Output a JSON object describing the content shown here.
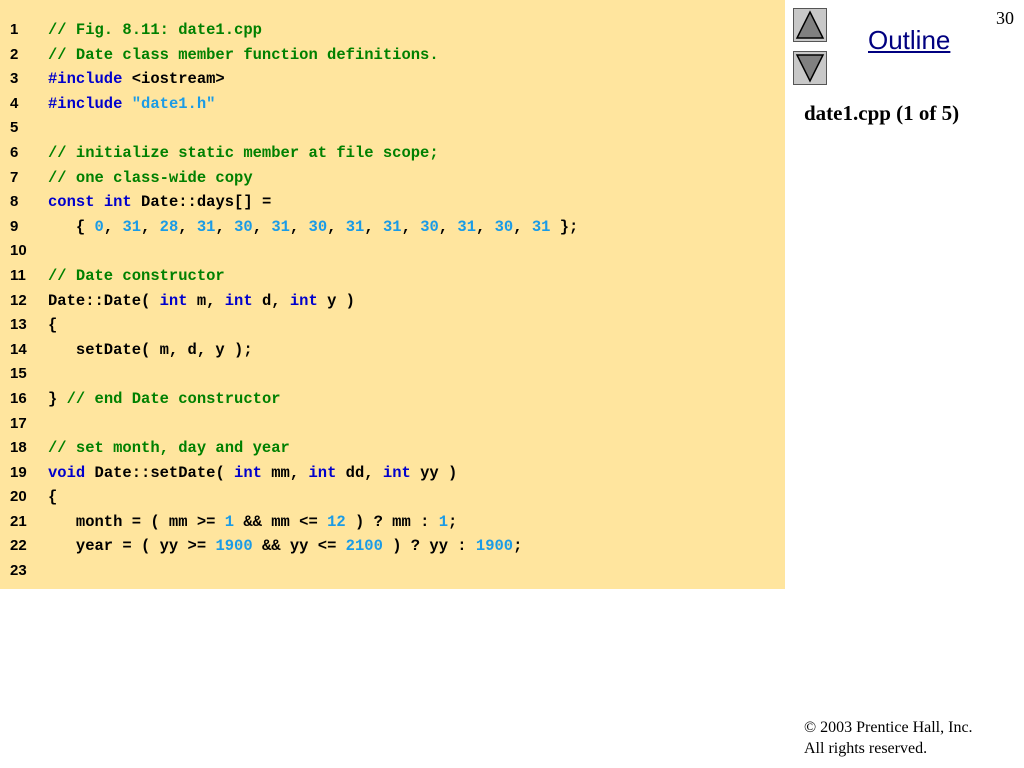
{
  "slide": {
    "page_number": "30",
    "outline_label": "Outline",
    "file_label": "date1.cpp (1 of 5)",
    "copyright_line1": "© 2003 Prentice Hall, Inc.",
    "copyright_line2": "All rights reserved.",
    "nav_up_icon": "triangle-up-icon",
    "nav_down_icon": "triangle-down-icon"
  },
  "colors": {
    "panel_background": "#ffe59e",
    "comment": "#008000",
    "keyword": "#0000cc",
    "number": "#1a9be6",
    "string": "#1a9be6",
    "plain": "#000000",
    "outline_link": "#000080"
  },
  "code_lines": [
    {
      "number": "1",
      "tokens": [
        {
          "t": "// Fig. 8.11: date1.cpp",
          "k": "comment"
        }
      ]
    },
    {
      "number": "2",
      "tokens": [
        {
          "t": "// Date class member function definitions.",
          "k": "comment"
        }
      ]
    },
    {
      "number": "3",
      "tokens": [
        {
          "t": "#include",
          "k": "keyword"
        },
        {
          "t": " <iostream>",
          "k": "plain"
        }
      ]
    },
    {
      "number": "4",
      "tokens": [
        {
          "t": "#include",
          "k": "keyword"
        },
        {
          "t": " ",
          "k": "plain"
        },
        {
          "t": "\"date1.h\"",
          "k": "string"
        }
      ]
    },
    {
      "number": "5",
      "tokens": []
    },
    {
      "number": "6",
      "tokens": [
        {
          "t": "// initialize static member at file scope;",
          "k": "comment"
        }
      ]
    },
    {
      "number": "7",
      "tokens": [
        {
          "t": "// one class-wide copy",
          "k": "comment"
        }
      ]
    },
    {
      "number": "8",
      "tokens": [
        {
          "t": "const",
          "k": "keyword"
        },
        {
          "t": " ",
          "k": "plain"
        },
        {
          "t": "int",
          "k": "keyword"
        },
        {
          "t": " Date::days[] =",
          "k": "plain"
        }
      ]
    },
    {
      "number": "9",
      "tokens": [
        {
          "t": "   { ",
          "k": "plain"
        },
        {
          "t": "0",
          "k": "number"
        },
        {
          "t": ", ",
          "k": "plain"
        },
        {
          "t": "31",
          "k": "number"
        },
        {
          "t": ", ",
          "k": "plain"
        },
        {
          "t": "28",
          "k": "number"
        },
        {
          "t": ", ",
          "k": "plain"
        },
        {
          "t": "31",
          "k": "number"
        },
        {
          "t": ", ",
          "k": "plain"
        },
        {
          "t": "30",
          "k": "number"
        },
        {
          "t": ", ",
          "k": "plain"
        },
        {
          "t": "31",
          "k": "number"
        },
        {
          "t": ", ",
          "k": "plain"
        },
        {
          "t": "30",
          "k": "number"
        },
        {
          "t": ", ",
          "k": "plain"
        },
        {
          "t": "31",
          "k": "number"
        },
        {
          "t": ", ",
          "k": "plain"
        },
        {
          "t": "31",
          "k": "number"
        },
        {
          "t": ", ",
          "k": "plain"
        },
        {
          "t": "30",
          "k": "number"
        },
        {
          "t": ", ",
          "k": "plain"
        },
        {
          "t": "31",
          "k": "number"
        },
        {
          "t": ", ",
          "k": "plain"
        },
        {
          "t": "30",
          "k": "number"
        },
        {
          "t": ", ",
          "k": "plain"
        },
        {
          "t": "31",
          "k": "number"
        },
        {
          "t": " };",
          "k": "plain"
        }
      ]
    },
    {
      "number": "10",
      "tokens": []
    },
    {
      "number": "11",
      "tokens": [
        {
          "t": "// Date constructor",
          "k": "comment"
        }
      ]
    },
    {
      "number": "12",
      "tokens": [
        {
          "t": "Date::Date( ",
          "k": "plain"
        },
        {
          "t": "int",
          "k": "keyword"
        },
        {
          "t": " m, ",
          "k": "plain"
        },
        {
          "t": "int",
          "k": "keyword"
        },
        {
          "t": " d, ",
          "k": "plain"
        },
        {
          "t": "int",
          "k": "keyword"
        },
        {
          "t": " y )",
          "k": "plain"
        }
      ]
    },
    {
      "number": "13",
      "tokens": [
        {
          "t": "{",
          "k": "plain"
        }
      ]
    },
    {
      "number": "14",
      "tokens": [
        {
          "t": "   setDate( m, d, y );",
          "k": "plain"
        }
      ]
    },
    {
      "number": "15",
      "tokens": []
    },
    {
      "number": "16",
      "tokens": [
        {
          "t": "} ",
          "k": "plain"
        },
        {
          "t": "// end Date constructor",
          "k": "comment"
        }
      ]
    },
    {
      "number": "17",
      "tokens": []
    },
    {
      "number": "18",
      "tokens": [
        {
          "t": "// set month, day and year",
          "k": "comment"
        }
      ]
    },
    {
      "number": "19",
      "tokens": [
        {
          "t": "void",
          "k": "keyword"
        },
        {
          "t": " Date::setDate( ",
          "k": "plain"
        },
        {
          "t": "int",
          "k": "keyword"
        },
        {
          "t": " mm, ",
          "k": "plain"
        },
        {
          "t": "int",
          "k": "keyword"
        },
        {
          "t": " dd, ",
          "k": "plain"
        },
        {
          "t": "int",
          "k": "keyword"
        },
        {
          "t": " yy )",
          "k": "plain"
        }
      ]
    },
    {
      "number": "20",
      "tokens": [
        {
          "t": "{",
          "k": "plain"
        }
      ]
    },
    {
      "number": "21",
      "tokens": [
        {
          "t": "   month = ( mm >= ",
          "k": "plain"
        },
        {
          "t": "1",
          "k": "number"
        },
        {
          "t": " && mm <= ",
          "k": "plain"
        },
        {
          "t": "12",
          "k": "number"
        },
        {
          "t": " ) ? mm : ",
          "k": "plain"
        },
        {
          "t": "1",
          "k": "number"
        },
        {
          "t": ";",
          "k": "plain"
        }
      ]
    },
    {
      "number": "22",
      "tokens": [
        {
          "t": "   year = ( yy >= ",
          "k": "plain"
        },
        {
          "t": "1900",
          "k": "number"
        },
        {
          "t": " && yy <= ",
          "k": "plain"
        },
        {
          "t": "2100",
          "k": "number"
        },
        {
          "t": " ) ? yy : ",
          "k": "plain"
        },
        {
          "t": "1900",
          "k": "number"
        },
        {
          "t": ";",
          "k": "plain"
        }
      ]
    },
    {
      "number": "23",
      "tokens": []
    }
  ]
}
